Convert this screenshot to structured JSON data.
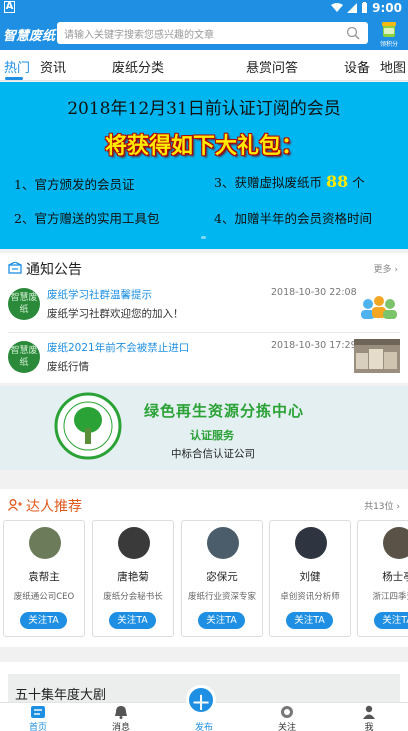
{
  "status_bar": {
    "notif_glyph": "A",
    "time": "9:00"
  },
  "header": {
    "logo": "智慧废纸",
    "search_placeholder": "请输入关键字搜索您感兴趣的文章",
    "signin_label": "领积分"
  },
  "tabs": [
    {
      "label": "热门",
      "active": true
    },
    {
      "label": "资讯"
    },
    {
      "label": "废纸分类"
    },
    {
      "label": "悬赏问答"
    },
    {
      "label": "设备"
    },
    {
      "label": "地图"
    }
  ],
  "banner": {
    "headline": "2018年12月31日前认证订阅的会员",
    "subheadline": "将获得如下大礼包：",
    "items": [
      "1、官方颁发的会员证",
      "3、获赠虚拟废纸币",
      "个",
      "2、官方赠送的实用工具包",
      "4、加赠半年的会员资格时间"
    ],
    "highlight": "88",
    "slide_count": 1
  },
  "notice": {
    "title": "通知公告",
    "more": "更多",
    "avatar_text": "智慧废纸",
    "rows": [
      {
        "title": "废纸学习社群温馨提示",
        "date": "2018-10-30 22:08",
        "desc": "废纸学习社群欢迎您的加入！"
      },
      {
        "title": "废纸2021年前不会被禁止进口",
        "date": "2018-10-30 17:29",
        "desc": "废纸行情"
      }
    ]
  },
  "ad": {
    "title": "绿色再生资源分拣中心",
    "subtitle": "认证服务",
    "company": "中标合信认证公司"
  },
  "experts": {
    "title": "达人推荐",
    "count": "共13位",
    "follow_label": "关注TA",
    "cards": [
      {
        "name": "袁帮主",
        "desc": "废纸通公司CEO"
      },
      {
        "name": "唐艳菊",
        "desc": "废纸分会秘书长"
      },
      {
        "name": "宓保元",
        "desc": "废纸行业资深专家"
      },
      {
        "name": "刘健",
        "desc": "卓创资讯分析师"
      },
      {
        "name": "杨士亭",
        "desc": "浙江四季资源"
      }
    ]
  },
  "article": {
    "title": "五十集年度大剧"
  },
  "bottom_nav": [
    {
      "label": "首页",
      "icon": "home-icon",
      "active": true
    },
    {
      "label": "消息",
      "icon": "bell-icon"
    },
    {
      "label": "发布",
      "icon": "plus-icon"
    },
    {
      "label": "关注",
      "icon": "follow-icon"
    },
    {
      "label": "我",
      "icon": "person-icon"
    }
  ],
  "colors": {
    "primary": "#1e8fe3",
    "banner_bg": "#00b6f0",
    "banner_accent": "#ffea00",
    "expert_title": "#e05a1d",
    "ad_green": "#2aa236"
  }
}
